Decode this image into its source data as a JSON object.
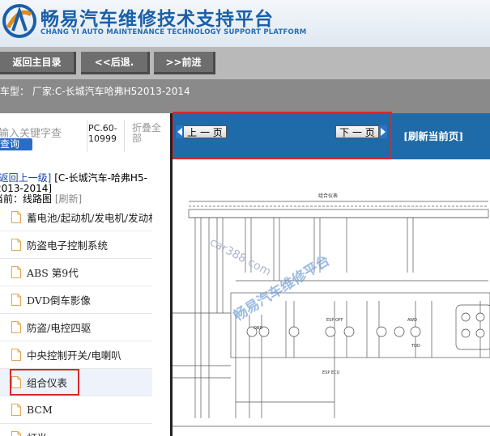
{
  "header": {
    "title": "畅易汽车维修技术支持平台",
    "subtitle": "CHANG YI AUTO MAINTENANCE TECHNOLOGY SUPPORT PLATFORM"
  },
  "nav": {
    "home": "返回主目录",
    "back": "<<后退.",
    "forward": ">>前进"
  },
  "car_info": "车型： 厂家:C-长城汽车哈弗H52013-2014",
  "left": {
    "search_hint": "输入关键字查",
    "search_button": "查询",
    "pc_code": "PC.60-10999",
    "collapse": "折叠全部",
    "breadcrumb_back": "[返回上一级]",
    "breadcrumb_path": "[C-长城汽车-哈弗H5-2013-2014]",
    "current_label": "当前：线路图",
    "current_refresh": "[刷新]",
    "menu": [
      {
        "label": "蓄电池/起动机/发电机/发动机电"
      },
      {
        "label": "防盗电子控制系统"
      },
      {
        "label": "ABS 第9代"
      },
      {
        "label": "DVD倒车影像"
      },
      {
        "label": "防盗/电控四驱"
      },
      {
        "label": "中央控制开关/电喇叭"
      },
      {
        "label": "组合仪表"
      },
      {
        "label": "BCM"
      },
      {
        "label": "灯光"
      }
    ]
  },
  "right": {
    "prev_page": "上 一 页",
    "next_page": "下 一 页",
    "refresh_page": "[刷新当前页]"
  },
  "diagram": {
    "title": "组合仪表",
    "watermark_domain": "car388.com",
    "watermark_text": "畅易汽车维修平台",
    "labels": [
      "OBD",
      "ESP OFF",
      "ESP ECU",
      "AWD",
      "TOD"
    ]
  },
  "colors": {
    "brand_blue": "#1a5fa8",
    "toolbar_blue": "#1f6aa8",
    "highlight_red": "#d42a2a"
  }
}
